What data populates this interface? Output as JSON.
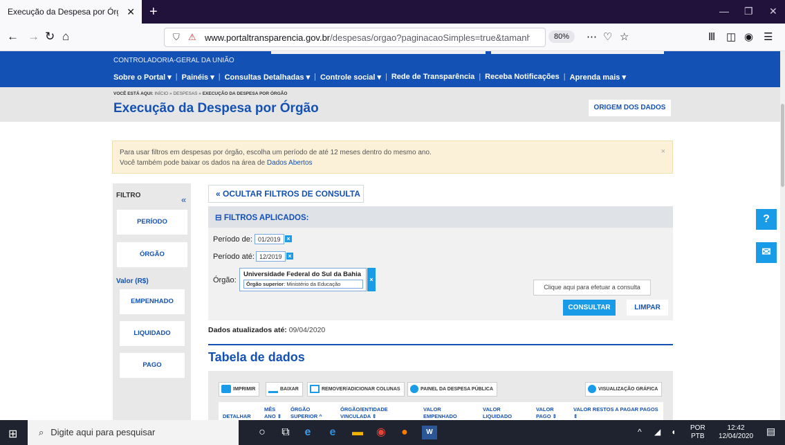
{
  "browser": {
    "tab_title": "Execução da Despesa por Órgã",
    "tab_close": "✕",
    "new_tab": "+",
    "url_domain": "www.portaltransparencia.gov.br",
    "url_path": "/despesas/orgao?paginacaoSimples=true&tamanhoPag",
    "zoom": "80%",
    "page_actions": "⋯"
  },
  "header": {
    "agency": "CONTROLADORIA-GERAL DA UNIÃO",
    "nav": [
      "Sobre o Portal ▾",
      "Painéis ▾",
      "Consultas Detalhadas ▾",
      "Controle social ▾",
      "Rede de Transparência",
      "Receba Notificações",
      "Aprenda mais ▾"
    ]
  },
  "breadcrumb": {
    "prefix": "VOCÊ ESTÁ AQUI:",
    "path": " INÍCIO » DESPESAS » ",
    "current": "EXECUÇÃO DA DESPESA POR ÓRGÃO"
  },
  "page": {
    "title": "Execução da Despesa por Órgão",
    "origem_button": "ORIGEM DOS DADOS"
  },
  "alert": {
    "line1": "Para usar filtros em despesas por órgão, escolha um período de até 12 meses dentro do mesmo ano.",
    "line2": "Você também pode baixar os dados na área de ",
    "link": "Dados Abertos",
    "close": "×"
  },
  "sidebar": {
    "title": "FILTRO",
    "collapse": "«",
    "periodo": "PERÍODO",
    "orgao": "ÓRGÃO",
    "valor_label": "Valor (R$)",
    "empenhado": "EMPENHADO",
    "liquidado": "LIQUIDADO",
    "pago": "PAGO"
  },
  "filters": {
    "toggle": "« OCULTAR FILTROS DE CONSULTA",
    "applied_title": "⊟  FILTROS APLICADOS:",
    "periodo_de_label": "Período de:",
    "periodo_de_value": "01/2019",
    "periodo_ate_label": "Período até:",
    "periodo_ate_value": "12/2019",
    "orgao_label": "Órgão:",
    "orgao_name": "Universidade Federal do Sul da Bahia",
    "orgao_superior_label": "Órgão superior",
    "orgao_superior_value": ": Ministério da Educação",
    "remove_icon": "×",
    "tooltip": "Clique aqui para efetuar a consulta",
    "consultar": "CONSULTAR",
    "limpar": "LIMPAR"
  },
  "data_section": {
    "updated_label": "Dados atualizados até:",
    "updated_value": " 09/04/2020",
    "table_title": "Tabela de dados",
    "tools": [
      "IMPRIMIR",
      "BAIXAR",
      "REMOVER/ADICIONAR COLUNAS",
      "PAINEL DA DESPESA PÚBLICA",
      "VISUALIZAÇÃO GRÁFICA"
    ],
    "columns": [
      "DETALHAR",
      "MÊS\nANO ⇕",
      "ÓRGÃO\nSUPERIOR ^",
      "ÓRGÃO/ENTIDADE\nVINCULADA ⇕",
      "VALOR\nEMPENHADO ⇕",
      "VALOR\nLIQUIDADO ⇕",
      "VALOR\nPAGO ⇕",
      "VALOR RESTOS A PAGAR PAGOS ⇕"
    ]
  },
  "floating": {
    "help": "?",
    "mail": "✉"
  },
  "taskbar": {
    "search_placeholder": "Digite aqui para pesquisar",
    "lang_top": "POR",
    "lang_bottom": "PTB",
    "time": "12:42",
    "date": "12/04/2020"
  },
  "colors": {
    "gov_blue": "#1351b4",
    "accent_blue": "#1a9be8",
    "alert_bg": "#fbf1d8"
  }
}
